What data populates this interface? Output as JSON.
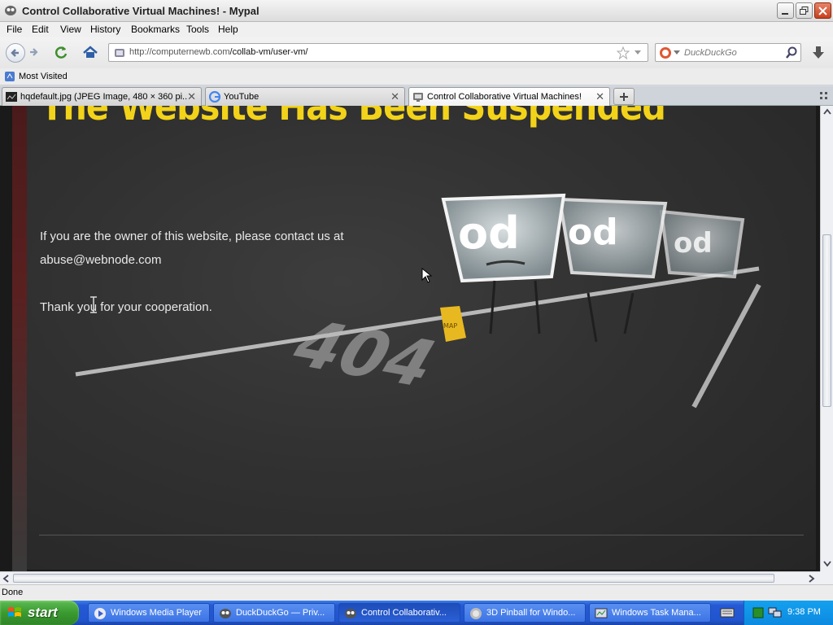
{
  "window": {
    "title": "Control Collaborative Virtual Machines! - Mypal"
  },
  "menu": [
    "File",
    "Edit",
    "View",
    "History",
    "Bookmarks",
    "Tools",
    "Help"
  ],
  "navigation": {
    "url_domain": "http://computernewb.com",
    "url_path": "/collab-vm/user-vm/",
    "search_placeholder": "DuckDuckGo"
  },
  "bookmarks": {
    "most_visited": "Most Visited"
  },
  "tabs": [
    {
      "label": "hqdefault.jpg (JPEG Image, 480 × 360 pi...",
      "active": false
    },
    {
      "label": "YouTube",
      "active": false
    },
    {
      "label": "Control Collaborative Virtual Machines!",
      "active": true
    }
  ],
  "page": {
    "headline": "The Website Has Been Suspended",
    "owner_text": "If you are the owner of this website, please contact us at",
    "email": "abuse@webnode.com",
    "thanks": "Thank you for your cooperation.",
    "map_tag": "MAP",
    "road_number": "404"
  },
  "status": {
    "text": "Done"
  },
  "taskbar": {
    "start": "start",
    "tasks": [
      {
        "label": "Windows Media Player",
        "active": false
      },
      {
        "label": "DuckDuckGo — Priv...",
        "active": false
      },
      {
        "label": "Control Collaborativ...",
        "active": true
      },
      {
        "label": "3D Pinball for Windo...",
        "active": false
      },
      {
        "label": "Windows Task Mana...",
        "active": false
      }
    ],
    "clock": "9:38 PM"
  },
  "colors": {
    "headline": "#f2d319",
    "taskbar": "#2155cf",
    "start": "#3a9a30"
  }
}
